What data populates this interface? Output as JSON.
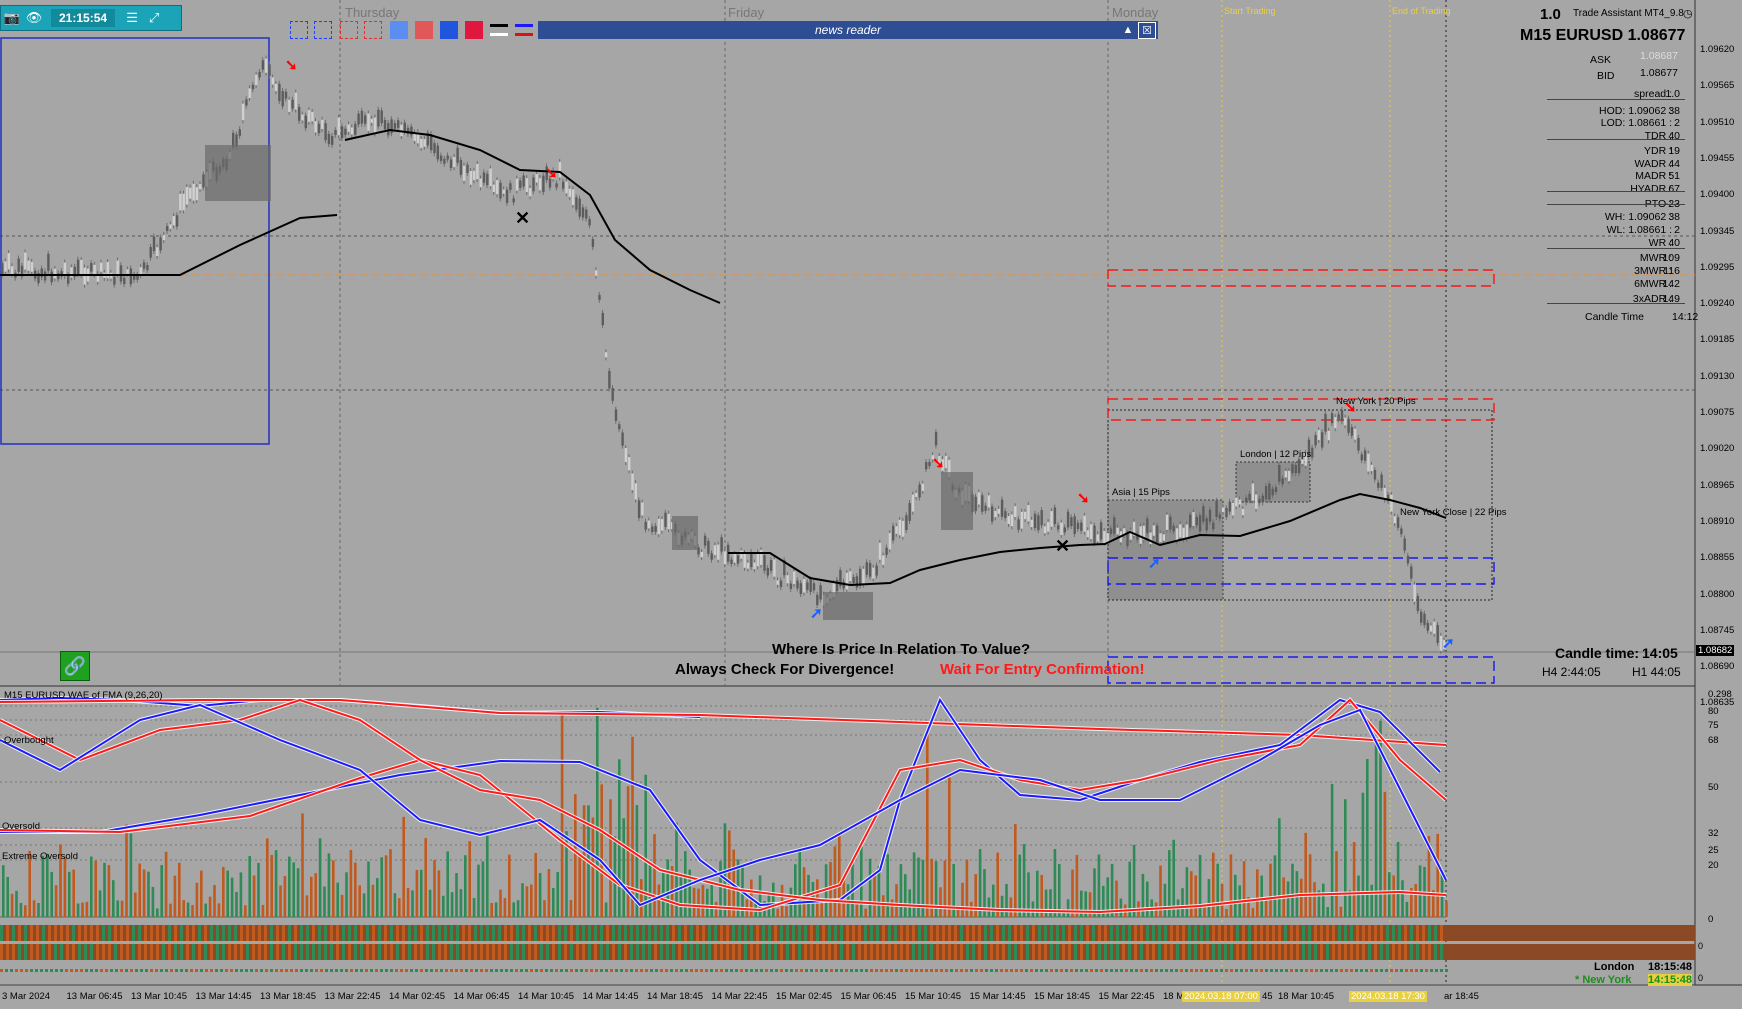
{
  "toolbar": {
    "time": "21:15:54",
    "camera_icon": "camera-icon",
    "eye_icon": "eye-icon",
    "menu_icon": "menu-icon",
    "expand_icon": "expand-icon"
  },
  "news_reader": {
    "label": "news reader",
    "collapse": "▲",
    "close": "☒"
  },
  "day_labels": [
    "Thursday",
    "Friday",
    "Monday"
  ],
  "session_labels": {
    "start": "Start Trading",
    "end": "End of Trading"
  },
  "top_right": {
    "version": "1.0",
    "title": "Trade Assistant MT4_9.8",
    "symbol": "M15 EURUSD 1.08677"
  },
  "info_panel": {
    "ask_label": "ASK",
    "ask": "1.08687",
    "bid_label": "BID",
    "bid": "1.08677",
    "rows": [
      {
        "k": "spread :",
        "v": "1.0"
      },
      {
        "k": "HOD: 1.09062 :",
        "v": "38"
      },
      {
        "k": "LOD: 1.08661 :",
        "v": "2"
      },
      {
        "k": "TDR :",
        "v": "40"
      },
      {
        "k": "YDR :",
        "v": "19"
      },
      {
        "k": "WADR :",
        "v": "44"
      },
      {
        "k": "MADR :",
        "v": "51"
      },
      {
        "k": "HYADR :",
        "v": "67"
      },
      {
        "k": "PTO :",
        "v": "-23"
      },
      {
        "k": "WH: 1.09062 :",
        "v": "38"
      },
      {
        "k": "WL: 1.08661 :",
        "v": "2"
      },
      {
        "k": "WR :",
        "v": "40"
      },
      {
        "k": "MWR :",
        "v": "109"
      },
      {
        "k": "3MWR :",
        "v": "116"
      },
      {
        "k": "6MWR :",
        "v": "142"
      },
      {
        "k": "3xADR :",
        "v": "149"
      }
    ],
    "candle_time_label": "Candle Time",
    "candle_time": "14:12"
  },
  "price_axis": [
    "1.09620",
    "1.09565",
    "1.09510",
    "1.09455",
    "1.09400",
    "1.09345",
    "1.09295",
    "1.09240",
    "1.09185",
    "1.09130",
    "1.09075",
    "1.09020",
    "1.08965",
    "1.08910",
    "1.08855",
    "1.08800",
    "1.08745",
    "1.08690",
    "1.08635"
  ],
  "current_price_tag": "1.08682",
  "sessions": {
    "asia": "Asia | 15 Pips",
    "london": "London | 12 Pips",
    "newyork": "New York | 20 Pips",
    "nyclose": "New York Close | 22 Pips"
  },
  "messages": {
    "line1": "Where Is Price In Relation To Value?",
    "line2": "Always Check For Divergence!",
    "line3": "Wait For Entry Confirmation!"
  },
  "candle_box": {
    "label": "Candle time:",
    "value": "14:05",
    "h4": "H4 2:44:05",
    "h1": "H1 44:05"
  },
  "indicator": {
    "title": "M15 EURUSD WAE of FMA (9,26,20)",
    "levels": [
      "Overbought",
      "Overbought",
      "Oversold",
      "Extreme Oversold"
    ],
    "axis": [
      "0.298",
      "80",
      "75",
      "68",
      "50",
      "32",
      "25",
      "20",
      "0"
    ],
    "mini_axis": [
      "0",
      "0"
    ]
  },
  "session_clock": {
    "london_label": "London",
    "london_time": "18:15:48",
    "ny_label": "* New York",
    "ny_time": "14:15:48"
  },
  "time_axis": [
    "3 Mar 2024",
    "13 Mar 06:45",
    "13 Mar 10:45",
    "13 Mar 14:45",
    "13 Mar 18:45",
    "13 Mar 22:45",
    "14 Mar 02:45",
    "14 Mar 06:45",
    "14 Mar 10:45",
    "14 Mar 14:45",
    "14 Mar 18:45",
    "14 Mar 22:45",
    "15 Mar 02:45",
    "15 Mar 06:45",
    "15 Mar 10:45",
    "15 Mar 14:45",
    "15 Mar 18:45",
    "15 Mar 22:45",
    "18 Mar",
    "45",
    "18 Mar 10:45",
    "ar 18:45"
  ],
  "time_highlights": [
    "2024.03.18 07:00",
    "2024.03.18 17:30"
  ],
  "colors": {
    "background": "#a6a6a6",
    "bull": "#2e8b57",
    "bear": "#c05a1e",
    "ma": "#000000",
    "blue_line": "#1a1aff",
    "red_line": "#ff1a1a",
    "session_yellow": "#e8d040",
    "zone_red": "#ff0000",
    "zone_blue": "#0000ff"
  }
}
